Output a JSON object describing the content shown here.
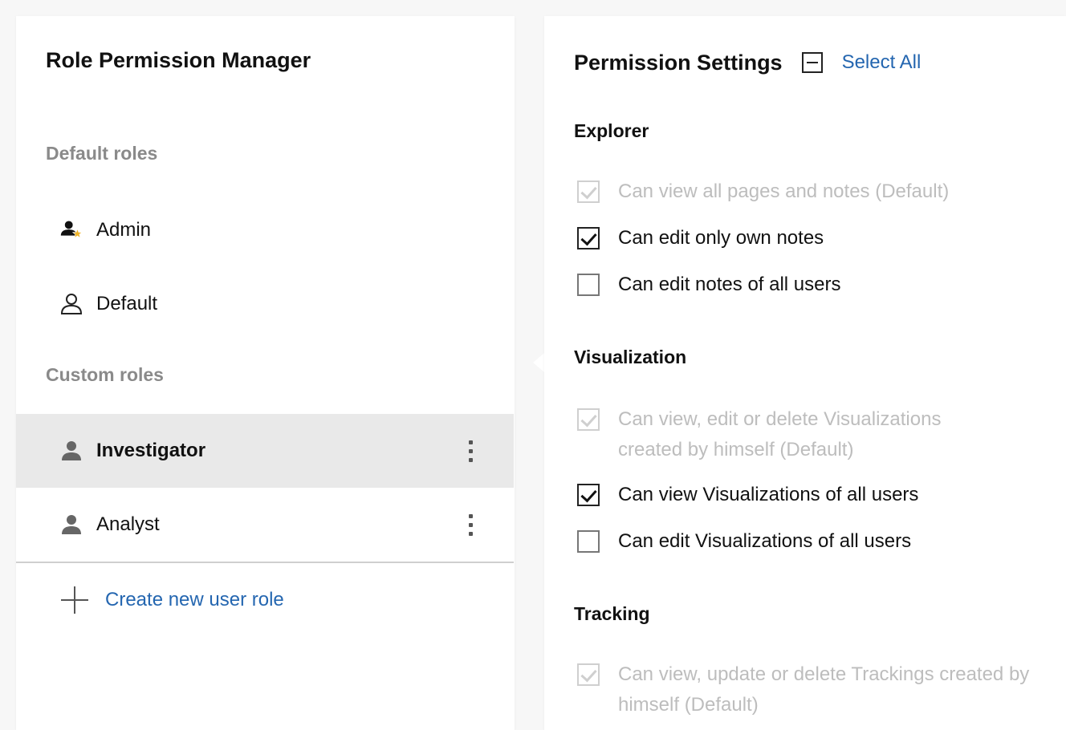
{
  "left": {
    "title": "Role Permission Manager",
    "default_section": "Default roles",
    "custom_section": "Custom roles",
    "default_roles": [
      {
        "label": "Admin",
        "icon": "admin-user-star-icon"
      },
      {
        "label": "Default",
        "icon": "user-outline-icon"
      }
    ],
    "custom_roles": [
      {
        "label": "Investigator",
        "icon": "user-icon",
        "selected": true
      },
      {
        "label": "Analyst",
        "icon": "user-icon",
        "selected": false
      }
    ],
    "create_label": "Create new user role"
  },
  "right": {
    "title": "Permission Settings",
    "select_all": "Select All",
    "groups": [
      {
        "title": "Explorer",
        "perms": [
          {
            "label": "Can view all pages and notes (Default)",
            "checked": true,
            "disabled": true
          },
          {
            "label": "Can edit only own notes",
            "checked": true,
            "disabled": false
          },
          {
            "label": "Can edit notes of all users",
            "checked": false,
            "disabled": false
          }
        ]
      },
      {
        "title": "Visualization",
        "perms": [
          {
            "label": "Can view, edit or delete Visualizations created by himself (Default)",
            "checked": true,
            "disabled": true
          },
          {
            "label": "Can view Visualizations of all users",
            "checked": true,
            "disabled": false
          },
          {
            "label": "Can edit Visualizations of all users",
            "checked": false,
            "disabled": false
          }
        ]
      },
      {
        "title": "Tracking",
        "perms": [
          {
            "label": "Can view, update or delete Trackings created by himself (Default)",
            "checked": true,
            "disabled": true
          }
        ]
      }
    ]
  },
  "colors": {
    "link": "#2466b0",
    "star": "#f0b429",
    "selected_row": "#e9e9e9",
    "disabled_text": "#bdbdbd"
  }
}
